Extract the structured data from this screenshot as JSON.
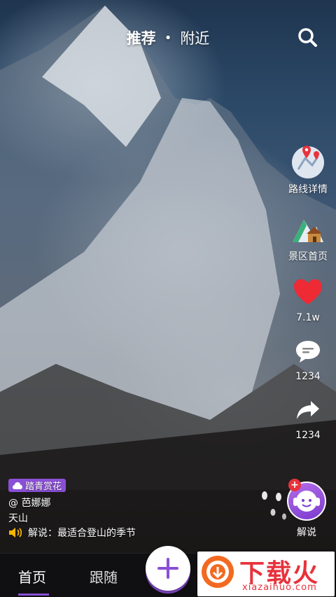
{
  "top_nav": {
    "recommended": "推荐",
    "separator": "•",
    "nearby": "附近"
  },
  "sidebar": {
    "route_label": "路线详情",
    "scenic_label": "景区首页",
    "like_count": "7.1w",
    "comment_count": "1234",
    "share_count": "1234"
  },
  "post": {
    "tag": "踏青赏花",
    "author": "@ 芭娜娜",
    "location": "天山",
    "audio_caption": "解说：最适合登山的季节"
  },
  "narration": {
    "badge": "+",
    "label": "解说"
  },
  "tabbar": {
    "home": "首页",
    "follow": "跟随"
  },
  "watermark": {
    "title": "下载火",
    "domain": "xiazaihuo.com"
  },
  "colors": {
    "accent": "#8a4fd6",
    "like": "#e8323c",
    "watermark": "#e8323c"
  }
}
